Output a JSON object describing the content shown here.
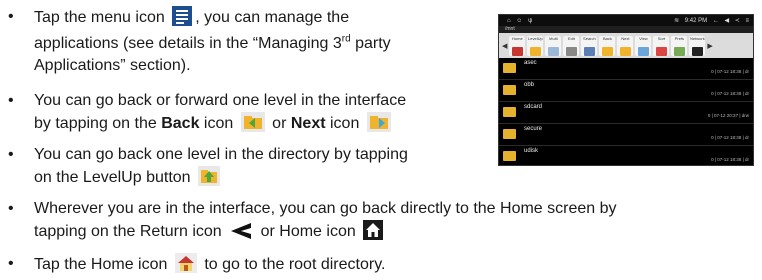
{
  "bullets": [
    {
      "line1_a": "Tap the menu icon",
      "line1_b": ", you can manage the",
      "line2": "applications (see details in the “Managing 3",
      "line2_sup": "rd",
      "line2_c": " party",
      "line3": "Applications” section)."
    },
    {
      "line1": "You can go back or forward one level in the interface",
      "line2_a": "by tapping on the ",
      "back": "Back",
      "line2_b": " icon",
      "or": "or",
      "next": "Next",
      "line2_c": "icon"
    },
    {
      "line1": "You can go back one level in the directory by tapping",
      "line2": "on the LevelUp button"
    },
    {
      "line1": "Wherever you are in the interface, you can go back directly to the Home screen by",
      "line2_a": "tapping on the Return icon",
      "line2_b": "or Home icon"
    },
    {
      "line1_a": "Tap the Home icon",
      "line1_b": "to go to the root directory."
    }
  ],
  "device": {
    "time": "9:42 PM",
    "path": "/mnt",
    "toolbar": [
      "Home",
      "LevelUp",
      "Multi",
      "Edit",
      "Search",
      "Back",
      "Next",
      "View",
      "Sort",
      "Prefs",
      "Network"
    ],
    "folders": [
      {
        "name": "asec",
        "meta": "0 | 07-12 18:38 | dr"
      },
      {
        "name": "obb",
        "meta": "0 | 07-12 18:38 | dr"
      },
      {
        "name": "sdcard",
        "meta": "0 | 07-12 20:37 | drw"
      },
      {
        "name": "secure",
        "meta": "0 | 07-12 18:38 | dr"
      },
      {
        "name": "udisk",
        "meta": "0 | 07-12 18:38 | dr"
      }
    ]
  },
  "colors": {
    "folder": "#e6b22b",
    "device_bg": "#000000",
    "toolbar": "#dcdcdc"
  }
}
